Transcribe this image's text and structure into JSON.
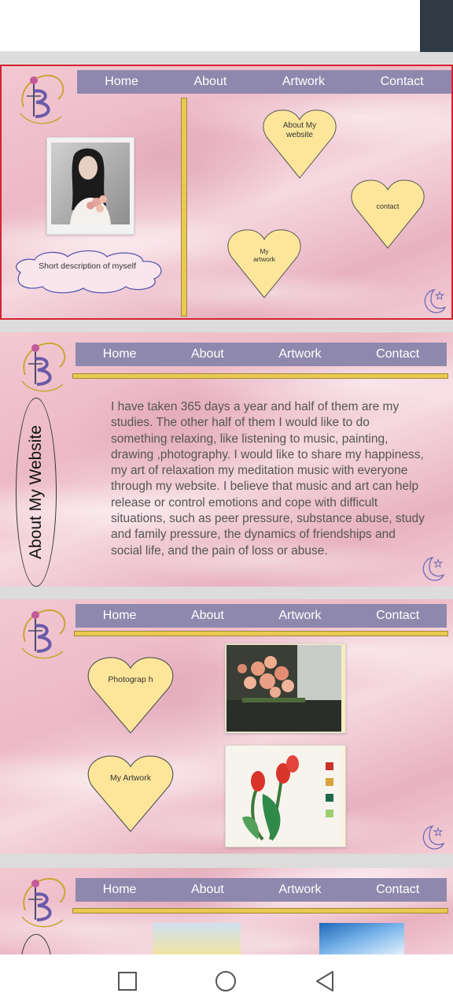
{
  "nav": {
    "home": "Home",
    "about": "About",
    "artwork": "Artwork",
    "contact": "Contact"
  },
  "slide1": {
    "hearts": {
      "about": "About My website",
      "contact": "contact",
      "artwork": "My artwork"
    },
    "cloud_text": "Short description of myself"
  },
  "slide2": {
    "oval_title": "About My Website",
    "paragraph": "I have taken 365 days a year and half of them are my studies. The other half of them I would like to do something relaxing, like listening to music, painting, drawing ,photography. I would like to share my happiness, my art of relaxation my meditation music with everyone through my website. I believe that music and art can help release or control emotions and cope with difficult situations, such as peer pressure, substance abuse, study and family pressure, the dynamics of friendships and social life, and the pain of loss or abuse."
  },
  "slide3": {
    "hearts": {
      "photography": "Photograp h",
      "artwork": "My Artwork"
    }
  },
  "colors": {
    "nav": "#8f88ad",
    "gold": "#e9c951",
    "heart": "#fde69a",
    "frame_red": "#d4232f"
  },
  "icons": {
    "logo": "b-monogram-logo",
    "moon": "crescent-moon-icon",
    "nav": [
      "square-icon",
      "circle-icon",
      "back-triangle-icon"
    ]
  }
}
